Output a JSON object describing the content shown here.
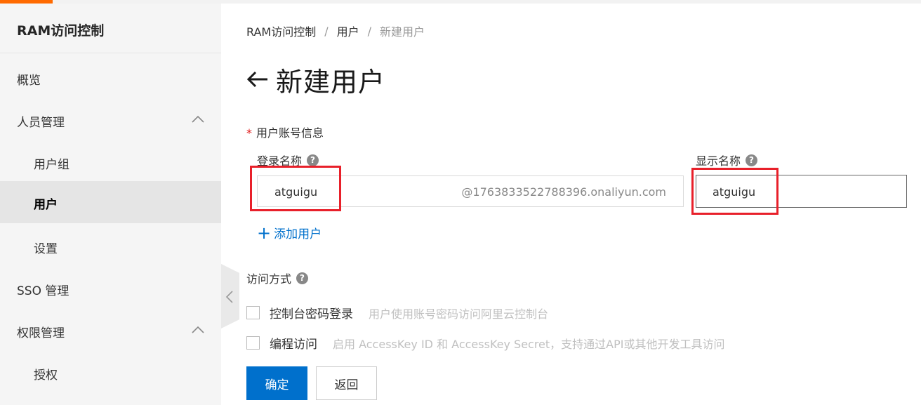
{
  "sidebar": {
    "title": "RAM访问控制",
    "items": [
      {
        "label": "概览"
      },
      {
        "label": "人员管理"
      },
      {
        "label": "用户组"
      },
      {
        "label": "用户"
      },
      {
        "label": "设置"
      },
      {
        "label": "SSO 管理"
      },
      {
        "label": "权限管理"
      },
      {
        "label": "授权"
      }
    ]
  },
  "breadcrumb": {
    "items": [
      "RAM访问控制",
      "用户",
      "新建用户"
    ],
    "separator": "/"
  },
  "page": {
    "title": "新建用户"
  },
  "form": {
    "account_section_label": "用户账号信息",
    "required_mark": "*",
    "login_name_label": "登录名称",
    "login_name_value": "atguigu",
    "login_domain_suffix": "@1763833522788396.onaliyun.com",
    "display_name_label": "显示名称",
    "display_name_value": "atguigu",
    "add_user_label": "添加用户",
    "add_user_plus": "+",
    "help_glyph": "?",
    "access_method_label": "访问方式",
    "options": [
      {
        "label": "控制台密码登录",
        "description": "用户使用账号密码访问阿里云控制台",
        "checked": false
      },
      {
        "label": "编程访问",
        "description": "启用 AccessKey ID 和 AccessKey Secret，支持通过API或其他开发工具访问",
        "checked": false
      }
    ]
  },
  "buttons": {
    "confirm": "确定",
    "back": "返回"
  },
  "colors": {
    "brand_orange": "#ff6a00",
    "primary_blue": "#0070cc",
    "highlight_red": "#e8202a"
  }
}
